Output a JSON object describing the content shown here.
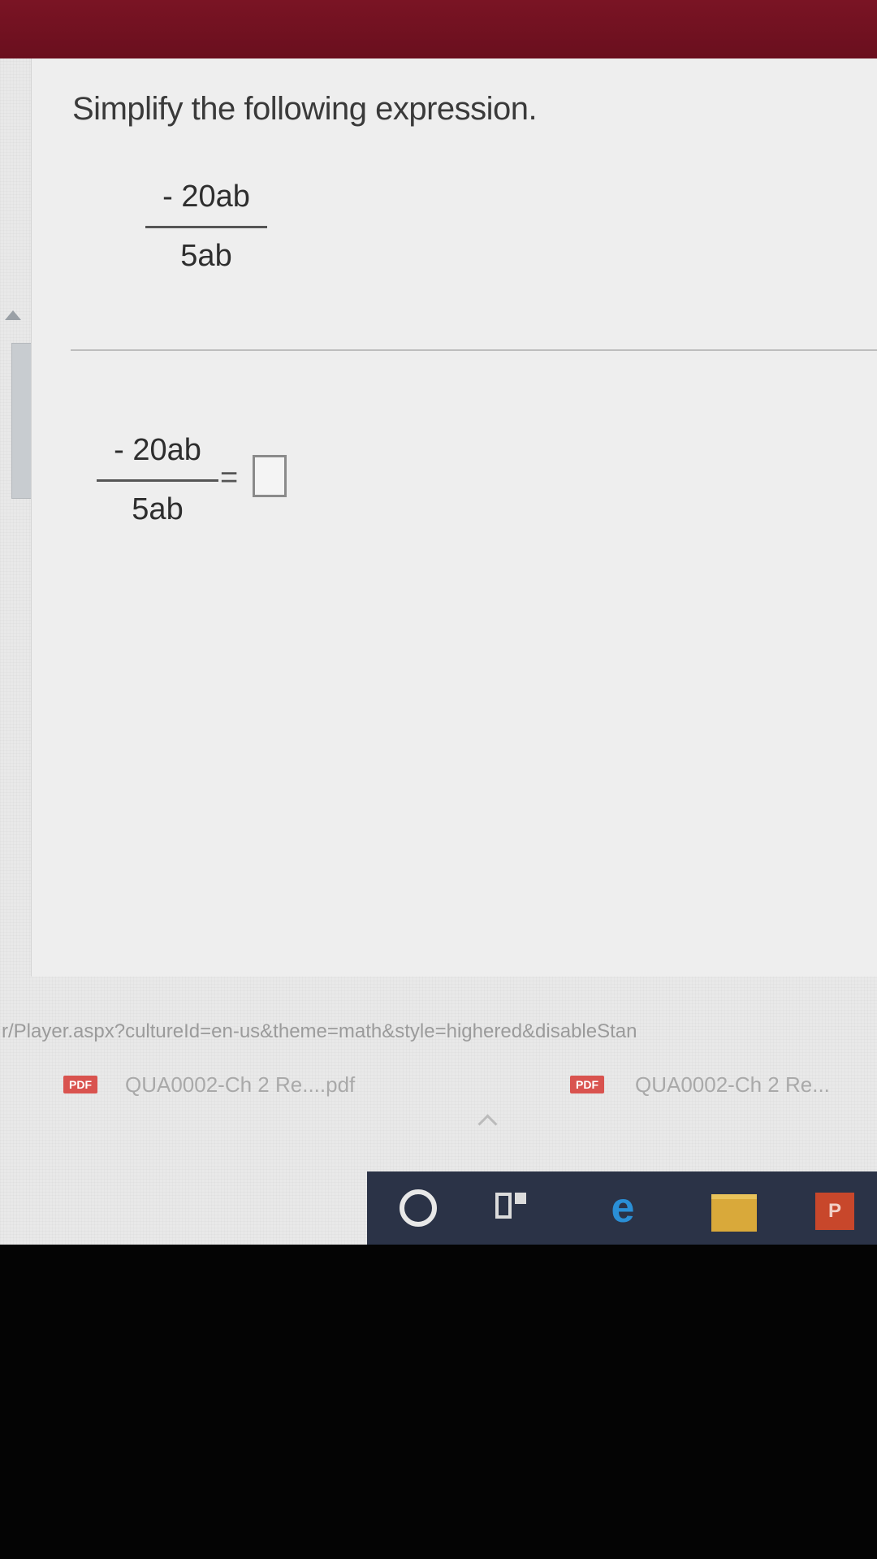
{
  "question": {
    "instruction": "Simplify the following expression.",
    "expression": {
      "numerator": "- 20ab",
      "denominator": "5ab"
    }
  },
  "answer": {
    "numerator": "- 20ab",
    "denominator": "5ab",
    "equals": "="
  },
  "status": {
    "url": "r/Player.aspx?cultureId=en-us&theme=math&style=highered&disableStan"
  },
  "downloads": [
    {
      "badge": "PDF",
      "name": "QUA0002-Ch 2 Re....pdf"
    },
    {
      "badge": "PDF",
      "name": "QUA0002-Ch 2 Re..."
    }
  ],
  "taskbar": {
    "edge_glyph": "e",
    "powerpoint_label": "P"
  }
}
